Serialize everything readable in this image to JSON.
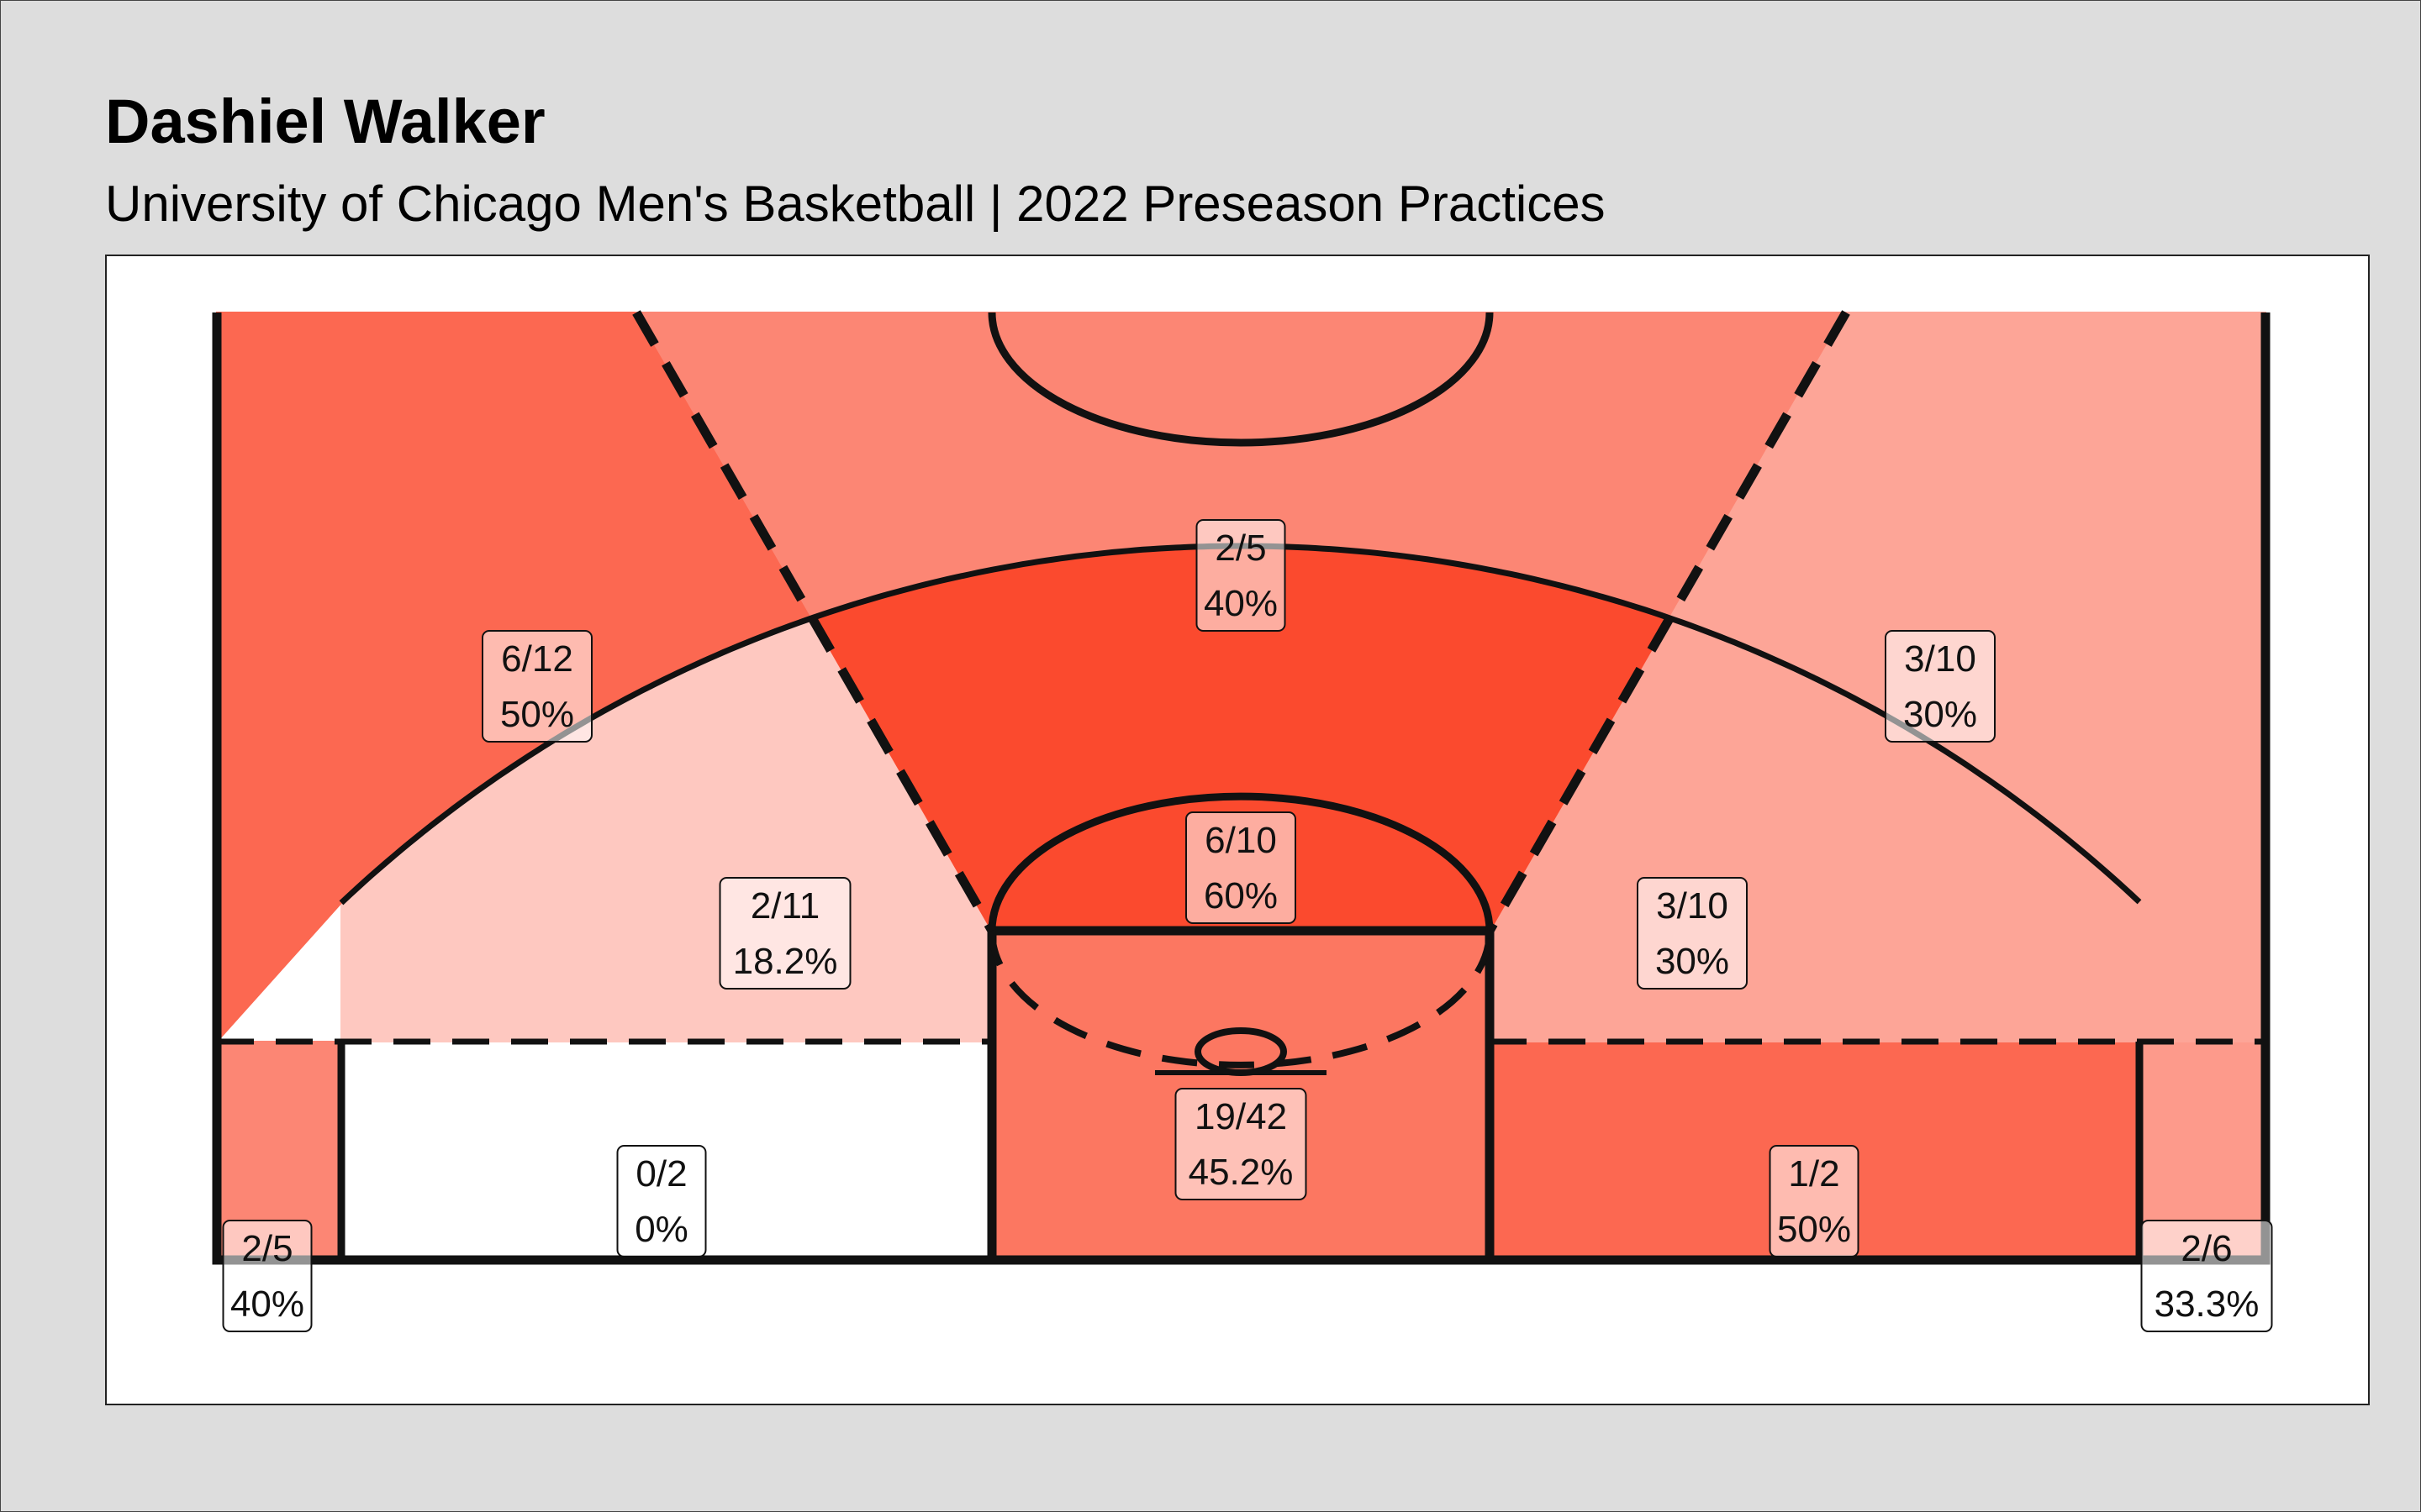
{
  "title": "Dashiel Walker",
  "subtitle": "University of Chicago Men's Basketball | 2022 Preseason Practices",
  "colors": {
    "page_background": "#dddddd",
    "panel_background": "#ffffff",
    "court_lines": "#111111",
    "scale_low": "#ffffff",
    "scale_high": "#fb4a2e"
  },
  "chart_data": {
    "type": "heatmap",
    "title": "Dashiel Walker",
    "subtitle": "University of Chicago Men's Basketball | 2022 Preseason Practices",
    "zones": [
      {
        "id": "left-corner-three",
        "label": "2/5",
        "pct": "40%",
        "made": 2,
        "attempts": 5
      },
      {
        "id": "left-baseline-two",
        "label": "0/2",
        "pct": "0%",
        "made": 0,
        "attempts": 2
      },
      {
        "id": "paint",
        "label": "19/42",
        "pct": "45.2%",
        "made": 19,
        "attempts": 42
      },
      {
        "id": "right-baseline-two",
        "label": "1/2",
        "pct": "50%",
        "made": 1,
        "attempts": 2
      },
      {
        "id": "right-corner-three",
        "label": "2/6",
        "pct": "33.3%",
        "made": 2,
        "attempts": 6
      },
      {
        "id": "left-wing-two",
        "label": "2/11",
        "pct": "18.2%",
        "made": 2,
        "attempts": 11
      },
      {
        "id": "top-key-two",
        "label": "6/10",
        "pct": "60%",
        "made": 6,
        "attempts": 10
      },
      {
        "id": "right-wing-two",
        "label": "3/10",
        "pct": "30%",
        "made": 3,
        "attempts": 10
      },
      {
        "id": "left-wing-three",
        "label": "6/12",
        "pct": "50%",
        "made": 6,
        "attempts": 12
      },
      {
        "id": "top-key-three",
        "label": "2/5",
        "pct": "40%",
        "made": 2,
        "attempts": 5
      },
      {
        "id": "right-wing-three",
        "label": "3/10",
        "pct": "30%",
        "made": 3,
        "attempts": 10
      }
    ]
  }
}
